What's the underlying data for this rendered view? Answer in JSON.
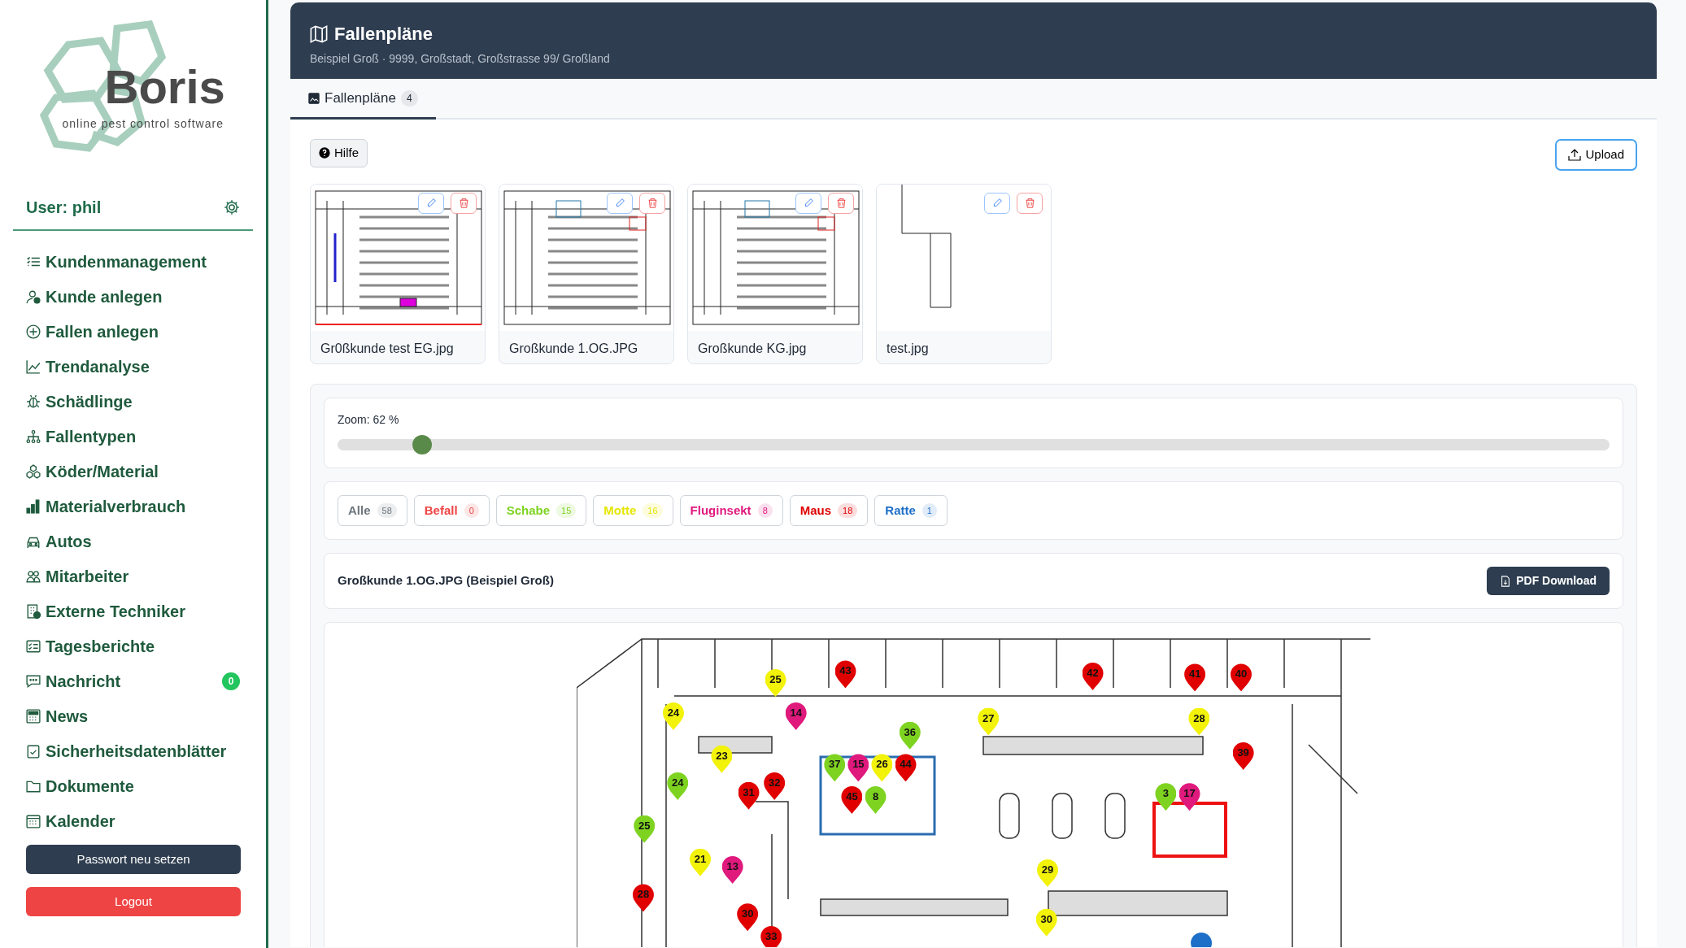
{
  "sidebar": {
    "logo": {
      "name": "Boris",
      "tagline": "online pest control software"
    },
    "user": "User: phil",
    "items": [
      {
        "label": "Kundenmanagement"
      },
      {
        "label": "Kunde anlegen"
      },
      {
        "label": "Fallen anlegen"
      },
      {
        "label": "Trendanalyse"
      },
      {
        "label": "Schädlinge"
      },
      {
        "label": "Fallentypen"
      },
      {
        "label": "Köder/Material"
      },
      {
        "label": "Materialverbrauch"
      },
      {
        "label": "Autos"
      },
      {
        "label": "Mitarbeiter"
      },
      {
        "label": "Externe Techniker"
      },
      {
        "label": "Tagesberichte"
      },
      {
        "label": "Nachricht",
        "badge": "0"
      },
      {
        "label": "News"
      },
      {
        "label": "Sicherheitsdatenblätter"
      },
      {
        "label": "Dokumente"
      },
      {
        "label": "Kalender"
      }
    ],
    "buttons": [
      {
        "label": "Passwort neu setzen",
        "kind": "dark"
      },
      {
        "label": "Logout",
        "kind": "danger"
      }
    ]
  },
  "header": {
    "title": "Fallenpläne",
    "subtitle": "Beispiel Groß · 9999, Großstadt, Großstrasse 99/ Großland"
  },
  "tabs": [
    {
      "label": "Fallenpläne",
      "count": "4",
      "selected": true
    }
  ],
  "help_button": "Hilfe",
  "upload_button": "Upload",
  "plans": [
    {
      "name": "Gr0ßkunde test EG.jpg",
      "kind": "colored"
    },
    {
      "name": "Großkunde 1.OG.JPG",
      "kind": "plan"
    },
    {
      "name": "Großkunde KG.jpg",
      "kind": "plan"
    },
    {
      "name": "test.jpg",
      "kind": "sketch"
    }
  ],
  "zoom": {
    "label": "Zoom: 62 %",
    "level": 0.06
  },
  "filters": [
    {
      "label": "Alle",
      "count": "58",
      "color": "#6c757d"
    },
    {
      "label": "Befall",
      "count": "0",
      "color": "#ef4444"
    },
    {
      "label": "Schabe",
      "count": "15",
      "color": "#7ed321"
    },
    {
      "label": "Motte",
      "count": "16",
      "color": "#e5e500"
    },
    {
      "label": "Fluginsekt",
      "count": "8",
      "color": "#e0197d"
    },
    {
      "label": "Maus",
      "count": "18",
      "color": "#e00000"
    },
    {
      "label": "Ratte",
      "count": "1",
      "color": "#1e6fc8"
    }
  ],
  "plan_title": "Großkunde 1.OG.JPG (Beispiel Groß)",
  "pdf_button": "PDF Download",
  "pins": [
    {
      "label": "25",
      "color": "#f2f20a"
    },
    {
      "label": "43",
      "color": "#e00000"
    },
    {
      "label": "42",
      "color": "#e00000"
    },
    {
      "label": "41",
      "color": "#e00000"
    },
    {
      "label": "40",
      "color": "#e00000"
    },
    {
      "label": "24",
      "color": "#f2f20a"
    },
    {
      "label": "14",
      "color": "#e0197d"
    },
    {
      "label": "27",
      "color": "#f2f20a"
    },
    {
      "label": "28",
      "color": "#f2f20a"
    },
    {
      "label": "36",
      "color": "#7ed321"
    },
    {
      "label": "23",
      "color": "#f2f20a"
    },
    {
      "label": "39",
      "color": "#e00000"
    },
    {
      "label": "37",
      "color": "#7ed321"
    },
    {
      "label": "15",
      "color": "#e0197d"
    },
    {
      "label": "26",
      "color": "#f2f20a"
    },
    {
      "label": "44",
      "color": "#e00000"
    },
    {
      "label": "24",
      "color": "#7ed321"
    },
    {
      "label": "32",
      "color": "#e00000"
    },
    {
      "label": "31",
      "color": "#e00000"
    },
    {
      "label": "45",
      "color": "#e00000"
    },
    {
      "label": "8",
      "color": "#7ed321"
    },
    {
      "label": "3",
      "color": "#7ed321"
    },
    {
      "label": "17",
      "color": "#e0197d"
    },
    {
      "label": "25",
      "color": "#7ed321"
    },
    {
      "label": "21",
      "color": "#f2f20a"
    },
    {
      "label": "13",
      "color": "#e0197d"
    },
    {
      "label": "29",
      "color": "#f2f20a"
    },
    {
      "label": "28",
      "color": "#e00000"
    },
    {
      "label": "30",
      "color": "#e00000"
    },
    {
      "label": "30",
      "color": "#f2f20a"
    },
    {
      "label": "33",
      "color": "#e00000"
    },
    {
      "color": "#1e6fc8"
    }
  ]
}
